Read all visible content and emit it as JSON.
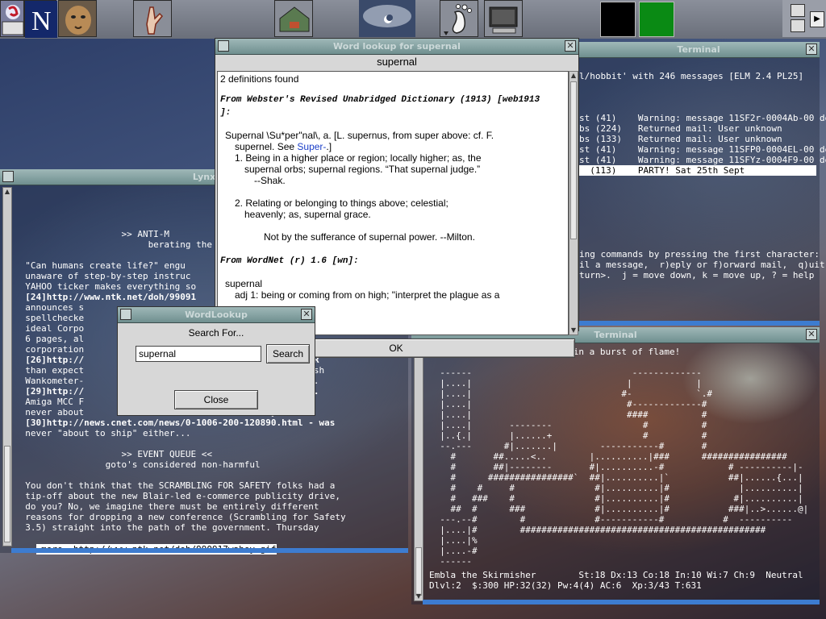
{
  "panel": {
    "launchers": [
      {
        "name": "debian-swirl-icon"
      },
      {
        "name": "netscape-icon",
        "label": "N"
      },
      {
        "name": "cougar-icon"
      },
      {
        "name": "hand-icon"
      },
      {
        "name": "toolbox-icon"
      },
      {
        "name": "moon-clock-icon"
      },
      {
        "name": "gnome-foot-icon"
      },
      {
        "name": "terminal-monitor-icon"
      }
    ],
    "pager_colors": [
      "#000000",
      "#0a8a14"
    ],
    "arrow_label": "▶"
  },
  "dict_window": {
    "title": "Word lookup for supernal",
    "word_header": "supernal",
    "count_line": "2 definitions found",
    "source1": "From Webster's Revised Unabridged Dictionary (1913) [web1913",
    "source1_tail": "]:",
    "entry_head": "Supernal \\Su*per\"nal\\, a. [L. supernus, from super above: cf. F.",
    "entry_head2_a": "supernel. See ",
    "entry_head2_link": "Super-",
    "entry_head2_b": ".]",
    "def1_a": "1. Being in a higher place or region; locally higher; as, the",
    "def1_b": "supernal orbs; supernal regions. “That supernal judge.”",
    "def1_c": "--Shak.",
    "def2_a": "2. Relating or belonging to things above; celestial;",
    "def2_b": "heavenly; as, supernal grace.",
    "quote": "Not by the sufferance of supernal power. --Milton.",
    "source2": "From WordNet (r) 1.6 [wn]:",
    "wn_word": "supernal",
    "wn_def": "adj 1: being or coming from on high; \"interpret the plague as a",
    "ok_label": "OK"
  },
  "search_window": {
    "title": "WordLookup",
    "prompt": "Search For...",
    "input_value": "supernal",
    "search_label": "Search",
    "close_label": "Close"
  },
  "lynx_window": {
    "title": "Lynx",
    "lines": [
      {
        "t": "                    >> ANTI-M"
      },
      {
        "t": "                         berating the"
      },
      {
        "t": ""
      },
      {
        "t": "  \"Can humans create life?\" engu"
      },
      {
        "t": "  unaware of step-by-step instruc"
      },
      {
        "t": "  YAHOO ticker makes everything so"
      },
      {
        "t": "  [24]http://www.ntk.net/doh/99091"
      },
      {
        "t": "  announces s"
      },
      {
        "t": "  spellchecke"
      },
      {
        "t": "  ideal Corpo"
      },
      {
        "t": "  6 pages, al"
      },
      {
        "t": "  corporation"
      },
      {
        "t": "  [26]http://                                   e SIMPLER"
      },
      {
        "t": "  than expect                                   Corner-ish"
      },
      {
        "t": "  Wankometer-                                   y.htm ..."
      },
      {
        "t": "  [29]http://                                   a-tags..."
      },
      {
        "t": "  Amiga MCC F                                   as"
      },
      {
        "t": "  never about                                   ystem\""
      },
      {
        "t": "  [30]http://news.cnet.com/news/0-1006-200-120890.html - was"
      },
      {
        "t": "  never \"about to ship\" either..."
      },
      {
        "t": ""
      },
      {
        "t": "                    >> EVENT QUEUE <<"
      },
      {
        "t": "                 goto's considered non-harmful"
      },
      {
        "t": ""
      },
      {
        "t": "  You don't think that the SCRAMBLING FOR SAFETY folks had a"
      },
      {
        "t": "  tip-off about the new Blair-led e-commerce publicity drive,"
      },
      {
        "t": "  do you? No, we imagine there must be entirely different"
      },
      {
        "t": "  reasons for dropping a new conference (Scrambling for Safety"
      },
      {
        "t": "  3.5) straight into the path of the government. Thursday"
      }
    ],
    "status": "-more- http://www.ntk.net/doh/990917wahey.gif"
  },
  "elm_window": {
    "title": "Terminal",
    "lines": [
      "l/hobbit' with 246 messages [ELM 2.4 PL25]",
      "",
      "",
      "",
      "st (41)    Warning: message 11SF2r-0004Ab-00 de",
      "bs (224)   Returned mail: User unknown",
      "bs (133)   Returned mail: User unknown",
      "st (41)    Warning: message 11SFP0-0004EL-00 de",
      "st (41)    Warning: message 11SFYz-0004F9-00 de",
      "  (113)    PARTY! Sat 25th Sept",
      "",
      "",
      "",
      "",
      "",
      "",
      "",
      "ing commands by pressing the first character:",
      "il a message,  r)eply or f)orward mail,  q)uit",
      "turn>.  j = move down, k = move up, ? = help"
    ],
    "selected_index": 9
  },
  "nethack_window": {
    "title": "Terminal",
    "message": "Your sacrifice is consumed in a burst of flame!",
    "map": [
      "",
      "  ------                              -------------",
      "  |....|                             |            |",
      "  |....|                            #-            `.#",
      "  |....|                             #-------------#",
      "  |....|                             ####          #",
      "  |....|       --------                 #          #",
      "  |..{.|       |......+                 #          #",
      "  --.---      #|.......|        -----------#       #",
      "    #       ##.....<..        |..........|###      ################",
      "    #       ##|--------       #|..........-#            # ----------|-",
      "    #      ################`  ##|..........|`           ##|......{...|",
      "    #    #     #               #|..........|#             |..........|",
      "    #   ###    #               #|..........|#            #|..........|",
      "    ##  #      ###             #|..........|#           ###|..>......@|",
      "  ---.--#        #             #-----------#           #  ----------",
      "  |....|#        ##############################################",
      "  |....|%",
      "  |....-#",
      "  ------"
    ],
    "status1": "Embla the Skirmisher        St:18 Dx:13 Co:18 In:10 Wi:7 Ch:9  Neutral",
    "status2": "Dlvl:2  $:300 HP:32(32) Pw:4(4) AC:6  Xp:3/43 T:631"
  }
}
